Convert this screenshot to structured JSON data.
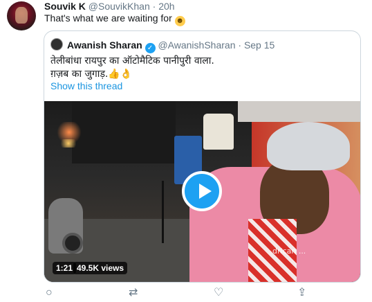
{
  "tweet": {
    "author_name": "Souvik K",
    "author_handle": "@SouvikKhan",
    "separator": "·",
    "time": "20h",
    "text": "That's what we are waiting for",
    "emoji": "☻"
  },
  "quoted": {
    "author_name": "Awanish Sharan",
    "verified_mark": "✓",
    "author_handle": "@AwanishSharan",
    "separator": "·",
    "date": "Sep 15",
    "text_line1": "तेलीबांधा रायपुर का ऑटोमैटिक पानीपुरी वाला.",
    "text_line2": "ग़ज़ब का जुगाड़.👍👌",
    "thread_link": "Show this thread",
    "video": {
      "duration": "1:21",
      "views": "49.5K views",
      "apron_text": "drican ..."
    }
  },
  "actions": {
    "reply_icon": "○",
    "retweet_icon": "⇄",
    "like_icon": "♡",
    "share_icon": "⇪"
  }
}
